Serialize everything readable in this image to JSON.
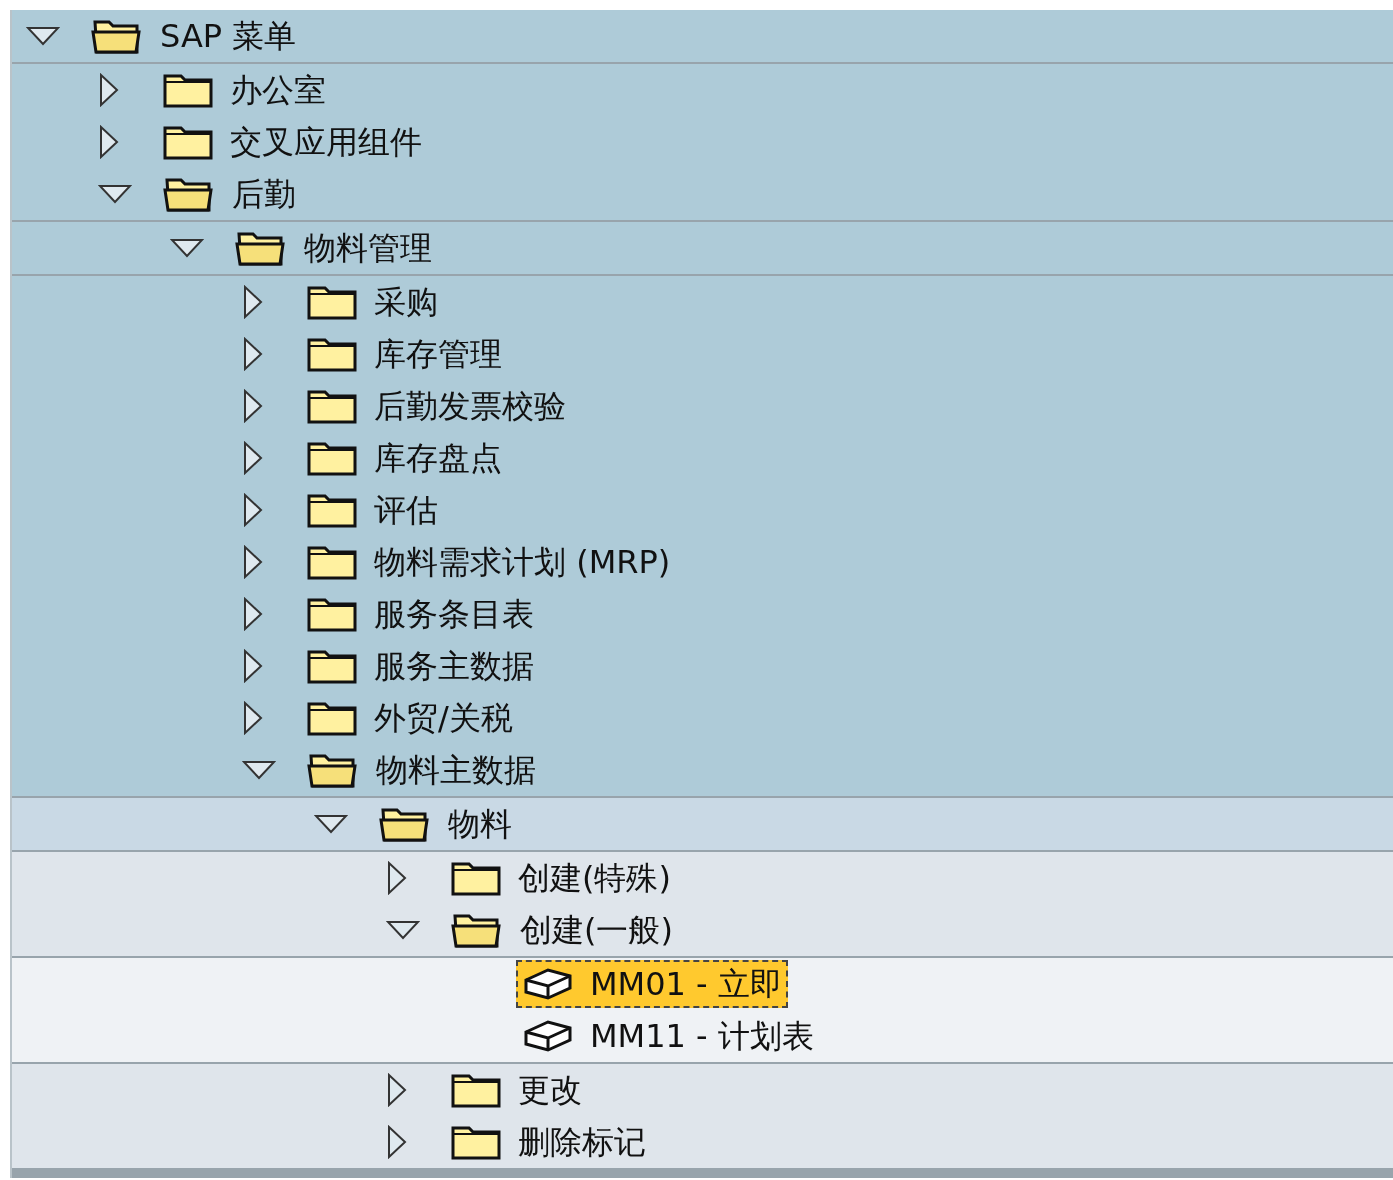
{
  "tree": [
    {
      "label": "SAP 菜单",
      "kind": "folder",
      "expanded": true,
      "selected": false,
      "children": [
        {
          "label": "办公室",
          "kind": "folder",
          "expanded": false,
          "selected": false
        },
        {
          "label": "交叉应用组件",
          "kind": "folder",
          "expanded": false,
          "selected": false
        },
        {
          "label": "后勤",
          "kind": "folder",
          "expanded": true,
          "selected": false,
          "children": [
            {
              "label": "物料管理",
              "kind": "folder",
              "expanded": true,
              "selected": false,
              "children": [
                {
                  "label": "采购",
                  "kind": "folder",
                  "expanded": false,
                  "selected": false
                },
                {
                  "label": "库存管理",
                  "kind": "folder",
                  "expanded": false,
                  "selected": false
                },
                {
                  "label": "后勤发票校验",
                  "kind": "folder",
                  "expanded": false,
                  "selected": false
                },
                {
                  "label": "库存盘点",
                  "kind": "folder",
                  "expanded": false,
                  "selected": false
                },
                {
                  "label": "评估",
                  "kind": "folder",
                  "expanded": false,
                  "selected": false
                },
                {
                  "label": "物料需求计划 (MRP)",
                  "kind": "folder",
                  "expanded": false,
                  "selected": false
                },
                {
                  "label": "服务条目表",
                  "kind": "folder",
                  "expanded": false,
                  "selected": false
                },
                {
                  "label": "服务主数据",
                  "kind": "folder",
                  "expanded": false,
                  "selected": false
                },
                {
                  "label": "外贸/关税",
                  "kind": "folder",
                  "expanded": false,
                  "selected": false
                },
                {
                  "label": "物料主数据",
                  "kind": "folder",
                  "expanded": true,
                  "selected": false,
                  "children": [
                    {
                      "label": "物料",
                      "kind": "folder",
                      "expanded": true,
                      "selected": false,
                      "children": [
                        {
                          "label": "创建(特殊)",
                          "kind": "folder",
                          "expanded": false,
                          "selected": false
                        },
                        {
                          "label": "创建(一般)",
                          "kind": "folder",
                          "expanded": true,
                          "selected": false,
                          "children": [
                            {
                              "label": "MM01 - 立即",
                              "kind": "transaction",
                              "selected": true
                            },
                            {
                              "label": "MM11 - 计划表",
                              "kind": "transaction",
                              "selected": false
                            }
                          ]
                        },
                        {
                          "label": "更改",
                          "kind": "folder",
                          "expanded": false,
                          "selected": false
                        },
                        {
                          "label": "删除标记",
                          "kind": "folder",
                          "expanded": false,
                          "selected": false
                        }
                      ]
                    }
                  ]
                }
              ]
            }
          ]
        }
      ]
    }
  ]
}
